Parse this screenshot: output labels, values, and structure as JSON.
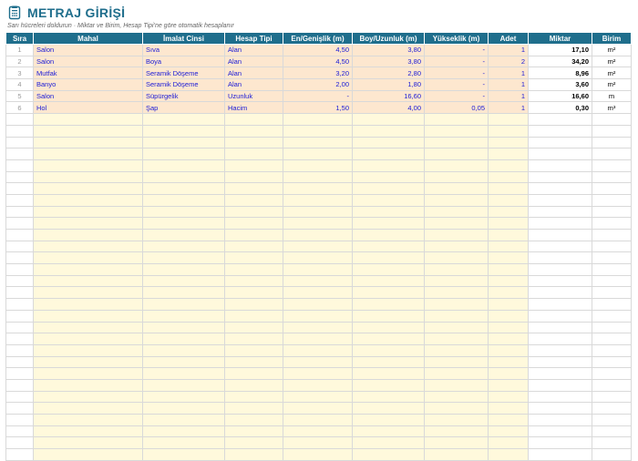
{
  "header": {
    "title": "METRAJ GİRİŞİ",
    "subtitle": "Sarı hücreleri doldurun · Miktar ve Birim, Hesap Tipi'ne göre otomatik hesaplanır",
    "icon": "spreadsheet-doc-icon"
  },
  "colors": {
    "header_bg": "#1f6e8c",
    "input_filled": "#fde7cf",
    "input_empty": "#fff9dc",
    "input_text": "#1a1ad6"
  },
  "table": {
    "columns": [
      "Sıra",
      "Mahal",
      "İmalat Cinsi",
      "Hesap Tipi",
      "En/Genişlik (m)",
      "Boy/Uzunluk (m)",
      "Yükseklik (m)",
      "Adet",
      "Miktar",
      "Birim"
    ],
    "rows": [
      {
        "sira": "1",
        "mahal": "Salon",
        "imalat": "Sıva",
        "hesap": "Alan",
        "en": "4,50",
        "boy": "3,80",
        "yuk": "-",
        "adet": "1",
        "miktar": "17,10",
        "birim": "m²"
      },
      {
        "sira": "2",
        "mahal": "Salon",
        "imalat": "Boya",
        "hesap": "Alan",
        "en": "4,50",
        "boy": "3,80",
        "yuk": "-",
        "adet": "2",
        "miktar": "34,20",
        "birim": "m²"
      },
      {
        "sira": "3",
        "mahal": "Mutfak",
        "imalat": "Seramik Döşeme",
        "hesap": "Alan",
        "en": "3,20",
        "boy": "2,80",
        "yuk": "-",
        "adet": "1",
        "miktar": "8,96",
        "birim": "m²"
      },
      {
        "sira": "4",
        "mahal": "Banyo",
        "imalat": "Seramik Döşeme",
        "hesap": "Alan",
        "en": "2,00",
        "boy": "1,80",
        "yuk": "-",
        "adet": "1",
        "miktar": "3,60",
        "birim": "m²"
      },
      {
        "sira": "5",
        "mahal": "Salon",
        "imalat": "Süpürgelik",
        "hesap": "Uzunluk",
        "en": "-",
        "boy": "16,60",
        "yuk": "-",
        "adet": "1",
        "miktar": "16,60",
        "birim": "m"
      },
      {
        "sira": "6",
        "mahal": "Hol",
        "imalat": "Şap",
        "hesap": "Hacim",
        "en": "1,50",
        "boy": "4,00",
        "yuk": "0,05",
        "adet": "1",
        "miktar": "0,30",
        "birim": "m³"
      }
    ],
    "empty_row_count": 30
  }
}
